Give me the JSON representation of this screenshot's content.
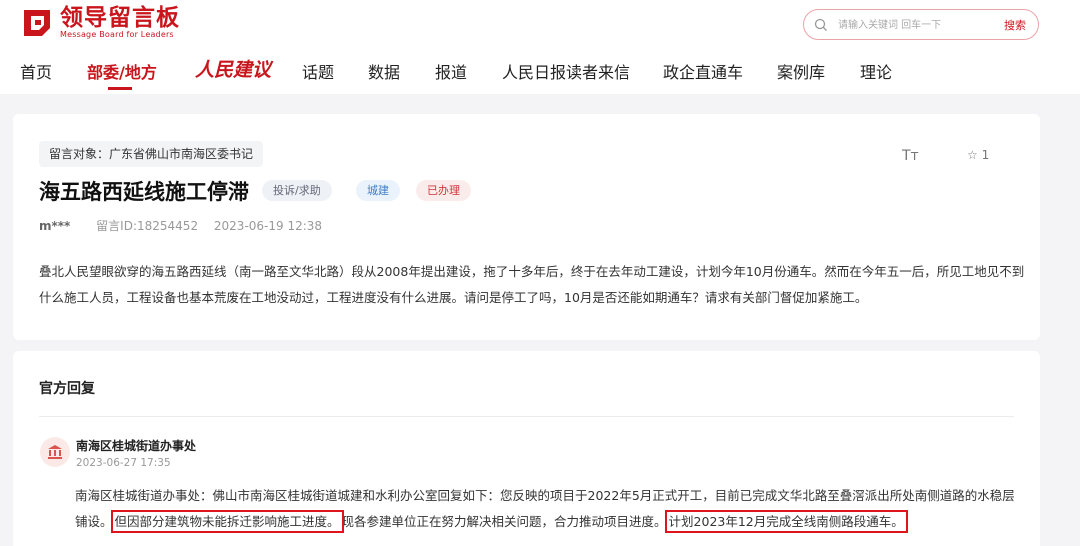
{
  "header": {
    "logo_title": "领导留言板",
    "logo_subtitle": "Message Board for Leaders",
    "search_placeholder": "请输入关键词 回车一下",
    "search_button": "搜索"
  },
  "nav": {
    "items": [
      "首页",
      "部委/地方",
      "人民建议",
      "话题",
      "数据",
      "报道",
      "人民日报读者来信",
      "政企直通车",
      "案例库",
      "理论"
    ],
    "active_index": 1
  },
  "message": {
    "target": "留言对象：广东省佛山市南海区委书记",
    "title": "海五路西延线施工停滞",
    "tags": [
      "投诉/求助",
      "城建",
      "已办理"
    ],
    "user": "m***",
    "message_id": "留言ID:18254452",
    "datetime": "2023-06-19 12:38",
    "star_count": "1",
    "font_icon": "Tт",
    "content": "叠北人民望眼欲穿的海五路西延线（南一路至文华北路）段从2008年提出建设，拖了十多年后，终于在去年动工建设，计划今年10月份通车。然而在今年五一后，所见工地见不到什么施工人员，工程设备也基本荒废在工地没动过，工程进度没有什么进展。请问是停工了吗，10月是否还能如期通车？请求有关部门督促加紧施工。"
  },
  "reply": {
    "heading": "官方回复",
    "org": "南海区桂城街道办事处",
    "datetime": "2023-06-27 17:35",
    "body_part1": "南海区桂城街道办事处：佛山市南海区桂城街道城建和水利办公室回复如下：您反映的项目于2022年5月正式开工，目前已完成文华北路至叠滘派出所处南侧道路的水稳层铺设。",
    "highlight1": "但因部分建筑物未能拆迁影响施工进度。",
    "body_part2": "现各参建单位正在努力解决相关问题，合力推动项目进度。",
    "highlight2": "计划2023年12月完成全线南侧路段通车。"
  },
  "colors": {
    "brand": "#c9161d",
    "highlight_box": "#e0141c"
  }
}
